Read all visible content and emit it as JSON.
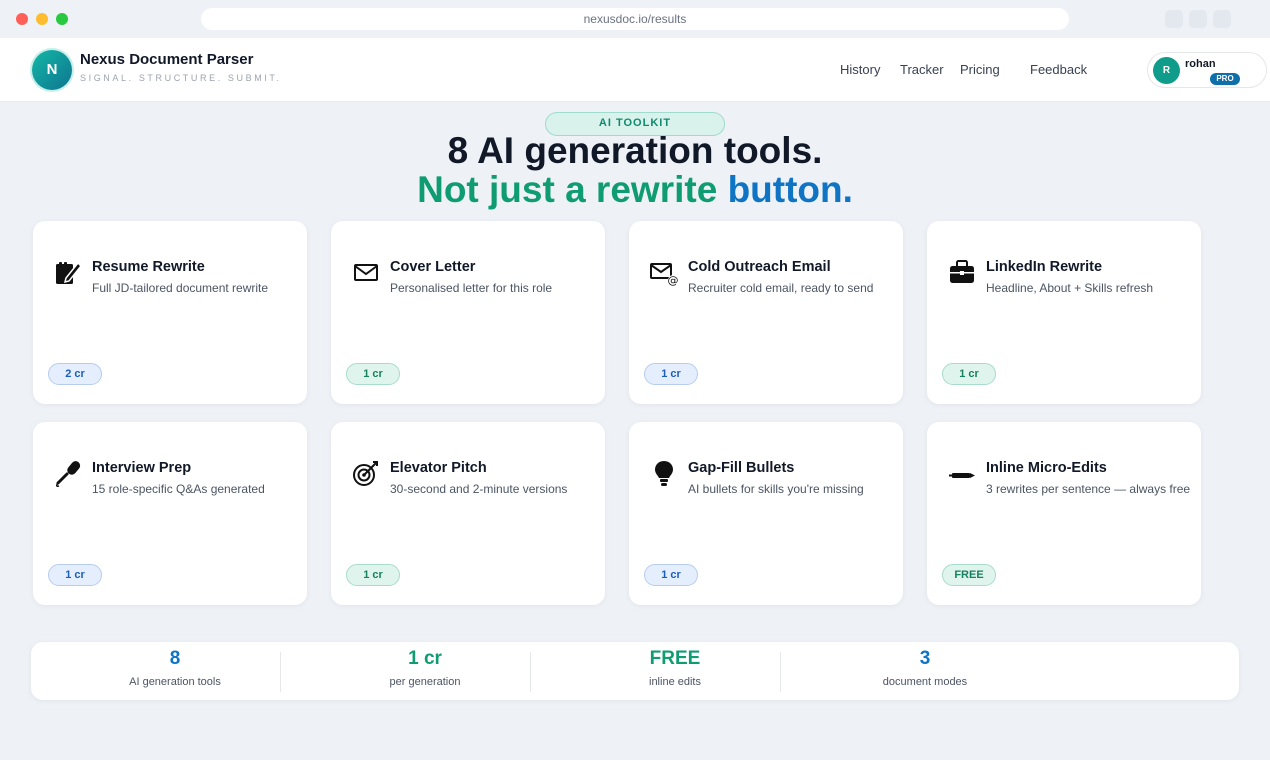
{
  "browser": {
    "url": "nexusdoc.io/results"
  },
  "header": {
    "logo_letter": "N",
    "brand_name": "Nexus Document Parser",
    "tagline": "SIGNAL. STRUCTURE. SUBMIT.",
    "nav": [
      "History",
      "Tracker",
      "Pricing",
      "Feedback"
    ],
    "user": {
      "initial": "R",
      "name": "rohan",
      "plan": "PRO"
    }
  },
  "hero": {
    "pill": "AI TOOLKIT",
    "title": "8 AI generation tools.",
    "subtitle_part1": "Not just a rewrite",
    "subtitle_part2": "button.",
    "colors": {
      "green": "#0f9c72",
      "blue": "#0f74c4"
    }
  },
  "tools": [
    {
      "icon": "memo-pencil-icon",
      "title": "Resume Rewrite",
      "desc": "Full JD-tailored document rewrite",
      "cost": "2 cr",
      "cost_style": "blue"
    },
    {
      "icon": "envelope-icon",
      "title": "Cover Letter",
      "desc": "Personalised letter for this role",
      "cost": "1 cr",
      "cost_style": "green"
    },
    {
      "icon": "email-at-icon",
      "title": "Cold Outreach Email",
      "desc": "Recruiter cold email, ready to send",
      "cost": "1 cr",
      "cost_style": "blue"
    },
    {
      "icon": "briefcase-icon",
      "title": "LinkedIn Rewrite",
      "desc": "Headline, About + Skills refresh",
      "cost": "1 cr",
      "cost_style": "green"
    },
    {
      "icon": "microphone-icon",
      "title": "Interview Prep",
      "desc": "15 role-specific Q&As generated",
      "cost": "1 cr",
      "cost_style": "blue"
    },
    {
      "icon": "target-icon",
      "title": "Elevator Pitch",
      "desc": "30-second and 2-minute versions",
      "cost": "1 cr",
      "cost_style": "green"
    },
    {
      "icon": "lightbulb-icon",
      "title": "Gap-Fill Bullets",
      "desc": "AI bullets for skills you're missing",
      "cost": "1 cr",
      "cost_style": "blue"
    },
    {
      "icon": "pen-icon",
      "title": "Inline Micro-Edits",
      "desc": "3 rewrites per sentence — always free",
      "cost": "FREE",
      "cost_style": "green"
    }
  ],
  "stats": [
    {
      "value": "8",
      "label": "AI generation tools",
      "color": "blue"
    },
    {
      "value": "1 cr",
      "label": "per generation",
      "color": "green"
    },
    {
      "value": "FREE",
      "label": "inline edits",
      "color": "green"
    },
    {
      "value": "3",
      "label": "document modes",
      "color": "blue"
    }
  ]
}
